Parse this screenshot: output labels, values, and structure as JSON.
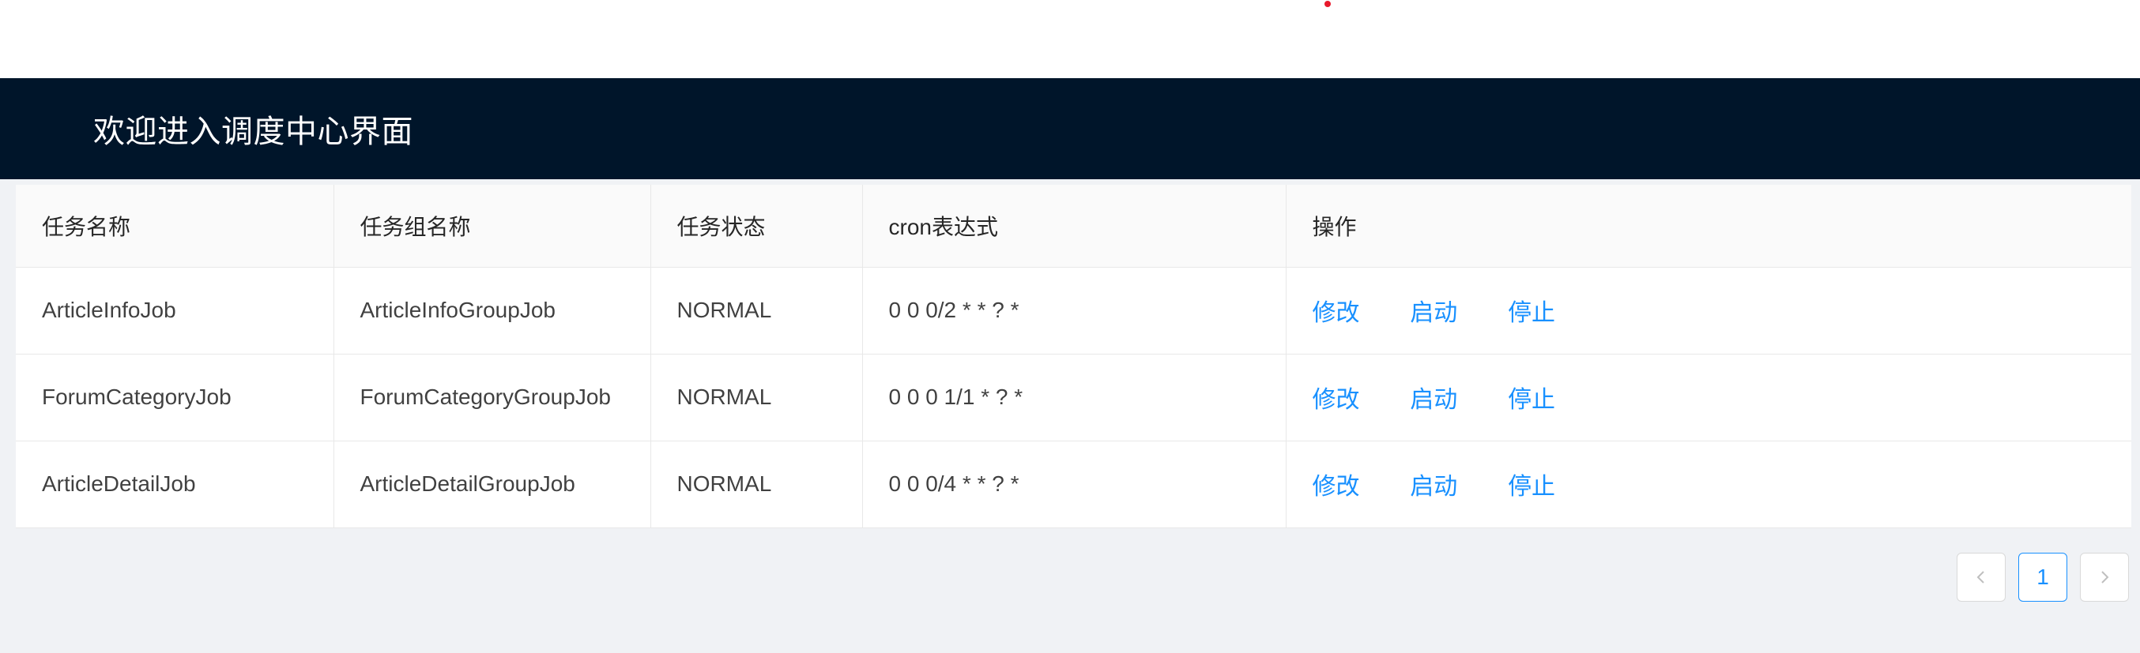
{
  "header": {
    "title": "欢迎进入调度中心界面"
  },
  "colors": {
    "header_bg": "#00152a",
    "link": "#1890ff",
    "marker": "#e8192c"
  },
  "table": {
    "columns": [
      "任务名称",
      "任务组名称",
      "任务状态",
      "cron表达式",
      "操作"
    ],
    "rows": [
      {
        "name": "ArticleInfoJob",
        "group": "ArticleInfoGroupJob",
        "status": "NORMAL",
        "cron": "0 0 0/2 * * ? *",
        "actions": [
          "修改",
          "启动",
          "停止"
        ]
      },
      {
        "name": "ForumCategoryJob",
        "group": "ForumCategoryGroupJob",
        "status": "NORMAL",
        "cron": "0 0 0 1/1 * ? *",
        "actions": [
          "修改",
          "启动",
          "停止"
        ]
      },
      {
        "name": "ArticleDetailJob",
        "group": "ArticleDetailGroupJob",
        "status": "NORMAL",
        "cron": "0 0 0/4 * * ? *",
        "actions": [
          "修改",
          "启动",
          "停止"
        ]
      }
    ]
  },
  "pagination": {
    "current_page": "1",
    "prev_icon": "chevron-left-icon",
    "next_icon": "chevron-right-icon"
  }
}
